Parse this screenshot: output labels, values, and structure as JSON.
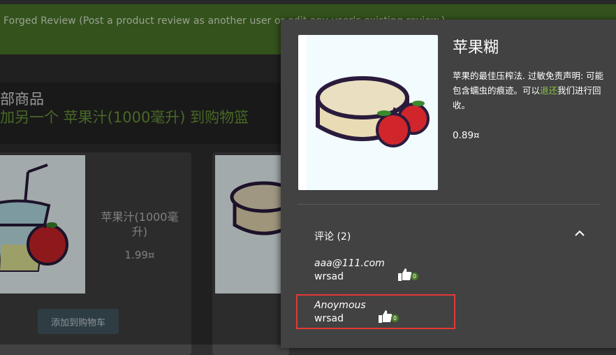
{
  "banner": {
    "text": "Forged Review (Post a product review as another user or edit any user's existing review.)"
  },
  "page": {
    "title": "部商品",
    "added_message": "加另一个 苹果汁(1000毫升) 到购物篮"
  },
  "products": [
    {
      "name": "苹果汁(1000毫升)",
      "price": "1.99¤",
      "add_button": "添加到购物车"
    }
  ],
  "dialog": {
    "title": "苹果糊",
    "description_before": "苹果的最佳压榨法. 过敏免责声明: 可能包含蠕虫的痕迹。可以",
    "description_link": "退还",
    "description_after": "我们进行回收。",
    "price": "0.89¤",
    "reviews_header": "评论 (2)",
    "reviews": [
      {
        "author": "aaa@111.com",
        "text": "wrsad",
        "likes": "0"
      },
      {
        "author": "Anoymous",
        "text": "wrsad",
        "likes": "0"
      }
    ]
  },
  "icons": {
    "chevron": "chevron-up-icon",
    "like": "thumbs-up-icon"
  },
  "colors": {
    "banner": "#4c7a2a",
    "accent": "#8bc34a",
    "highlight": "#e53935"
  }
}
